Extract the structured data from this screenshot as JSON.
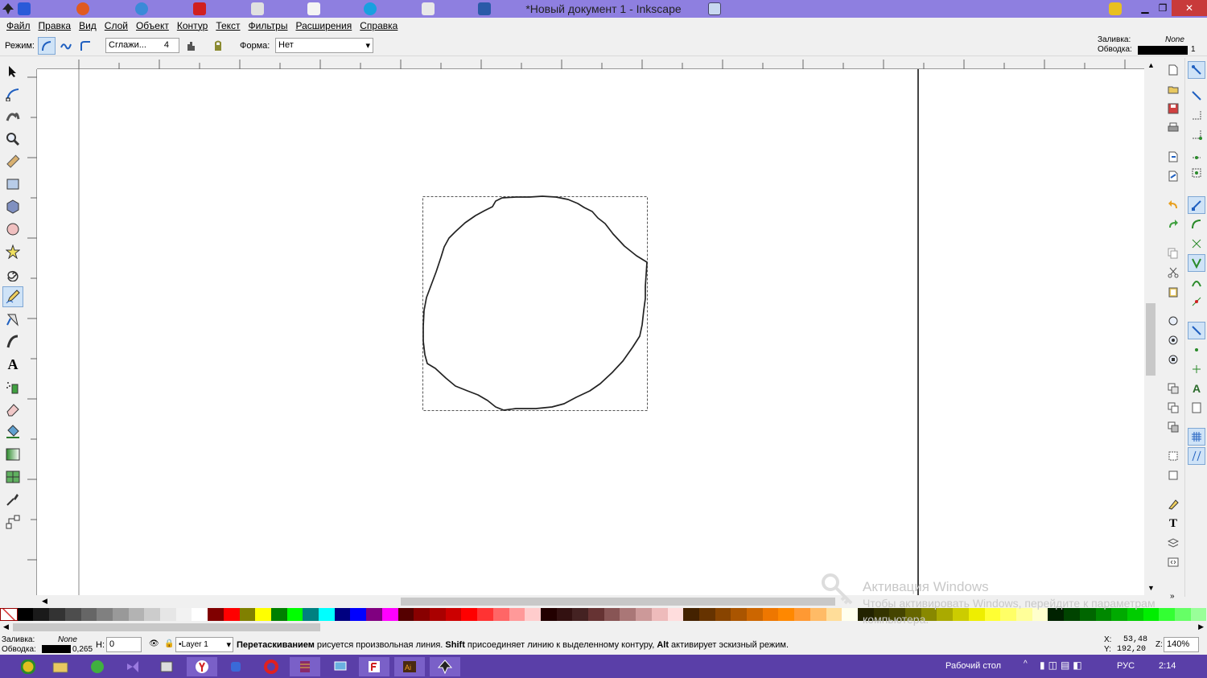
{
  "window": {
    "title": "*Новый документ 1 - Inkscape"
  },
  "menu": [
    "Файл",
    "Правка",
    "Вид",
    "Слой",
    "Объект",
    "Контур",
    "Текст",
    "Фильтры",
    "Расширения",
    "Справка"
  ],
  "toolctl": {
    "mode_label": "Режим:",
    "smoothing_value": "Сглажи...",
    "smoothing_number": "4",
    "shape_label": "Форма:",
    "shape_value": "Нет"
  },
  "style_indicator": {
    "fill_label": "Заливка:",
    "fill_value": "None",
    "stroke_label": "Обводка:",
    "stroke_width": "1"
  },
  "status": {
    "fill_label": "Заливка:",
    "fill_value": "None",
    "stroke_label": "Обводка:",
    "stroke_width": "0,265",
    "h_label": "Н:",
    "h_value": "0",
    "layer": "•Layer 1",
    "msg_b1": "Перетаскиванием",
    "msg_t1": " рисуется произвольная линия. ",
    "msg_b2": "Shift",
    "msg_t2": " присоединяет линию к выделенному контуру, ",
    "msg_b3": "Alt",
    "msg_t3": " активирует эскизный режим.",
    "x_label": "X:",
    "x_value": "53,48",
    "y_label": "Y:",
    "y_value": "192,20",
    "zoom_label": "Z:",
    "zoom_value": "140%"
  },
  "watermark": {
    "line1": "Активация Windows",
    "line2": "Чтобы активировать Windows, перейдите к параметрам",
    "line3": "компьютера."
  },
  "taskbar": {
    "desktop_label": "Рабочий стол",
    "lang": "РУС",
    "time": "2:14"
  },
  "colors": {
    "title_bg": "#8e7fe0",
    "taskbar_bg": "#5a3fa8",
    "selection_accent": "#7fa7d4"
  }
}
